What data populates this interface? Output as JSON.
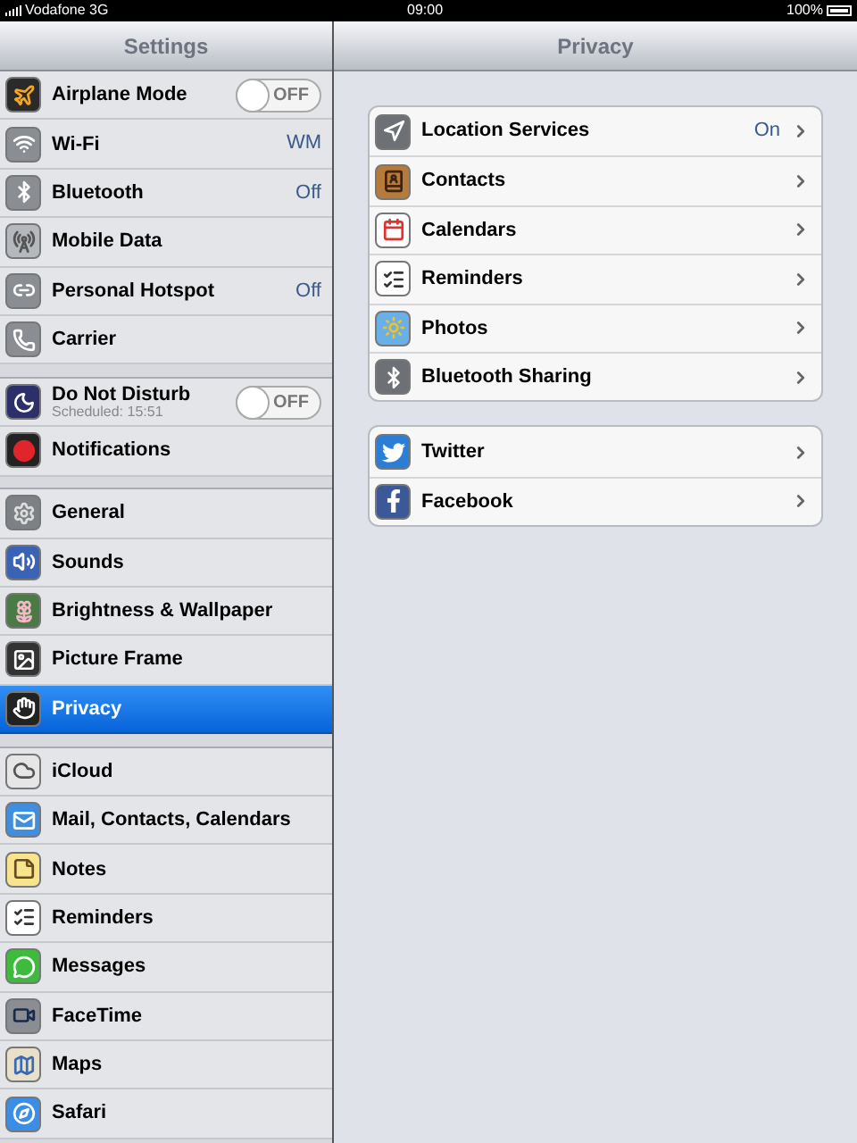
{
  "status_bar": {
    "carrier": "Vodafone 3G",
    "time": "09:00",
    "battery": "100%"
  },
  "sidebar": {
    "title": "Settings",
    "groups": [
      {
        "items": [
          {
            "kind": "toggle",
            "label": "Airplane Mode",
            "on": false,
            "toggle_text": "OFF",
            "selected": false
          },
          {
            "kind": "value",
            "label": "Wi-Fi",
            "value": "WM",
            "selected": false
          },
          {
            "kind": "value",
            "label": "Bluetooth",
            "value": "Off",
            "selected": false
          },
          {
            "kind": "plain",
            "label": "Mobile Data",
            "selected": false
          },
          {
            "kind": "value",
            "label": "Personal Hotspot",
            "value": "Off",
            "selected": false
          },
          {
            "kind": "plain",
            "label": "Carrier",
            "selected": false
          }
        ]
      },
      {
        "items": [
          {
            "kind": "toggle",
            "label": "Do Not Disturb",
            "subtitle": "Scheduled: 15:51",
            "on": false,
            "toggle_text": "OFF",
            "selected": false
          },
          {
            "kind": "plain",
            "label": "Notifications",
            "selected": false
          }
        ]
      },
      {
        "items": [
          {
            "kind": "plain",
            "label": "General",
            "selected": false
          },
          {
            "kind": "plain",
            "label": "Sounds",
            "selected": false
          },
          {
            "kind": "plain",
            "label": "Brightness & Wallpaper",
            "selected": false
          },
          {
            "kind": "plain",
            "label": "Picture Frame",
            "selected": false
          },
          {
            "kind": "plain",
            "label": "Privacy",
            "selected": true
          }
        ]
      },
      {
        "items": [
          {
            "kind": "plain",
            "label": "iCloud",
            "selected": false
          },
          {
            "kind": "plain",
            "label": "Mail, Contacts, Calendars",
            "selected": false
          },
          {
            "kind": "plain",
            "label": "Notes",
            "selected": false
          },
          {
            "kind": "plain",
            "label": "Reminders",
            "selected": false
          },
          {
            "kind": "plain",
            "label": "Messages",
            "selected": false
          },
          {
            "kind": "plain",
            "label": "FaceTime",
            "selected": false
          },
          {
            "kind": "plain",
            "label": "Maps",
            "selected": false
          },
          {
            "kind": "plain",
            "label": "Safari",
            "selected": false
          }
        ]
      }
    ]
  },
  "detail": {
    "title": "Privacy",
    "groups": [
      {
        "items": [
          {
            "label": "Location Services",
            "value": "On"
          },
          {
            "label": "Contacts"
          },
          {
            "label": "Calendars"
          },
          {
            "label": "Reminders"
          },
          {
            "label": "Photos"
          },
          {
            "label": "Bluetooth Sharing"
          }
        ]
      },
      {
        "items": [
          {
            "label": "Twitter"
          },
          {
            "label": "Facebook"
          }
        ]
      }
    ]
  }
}
